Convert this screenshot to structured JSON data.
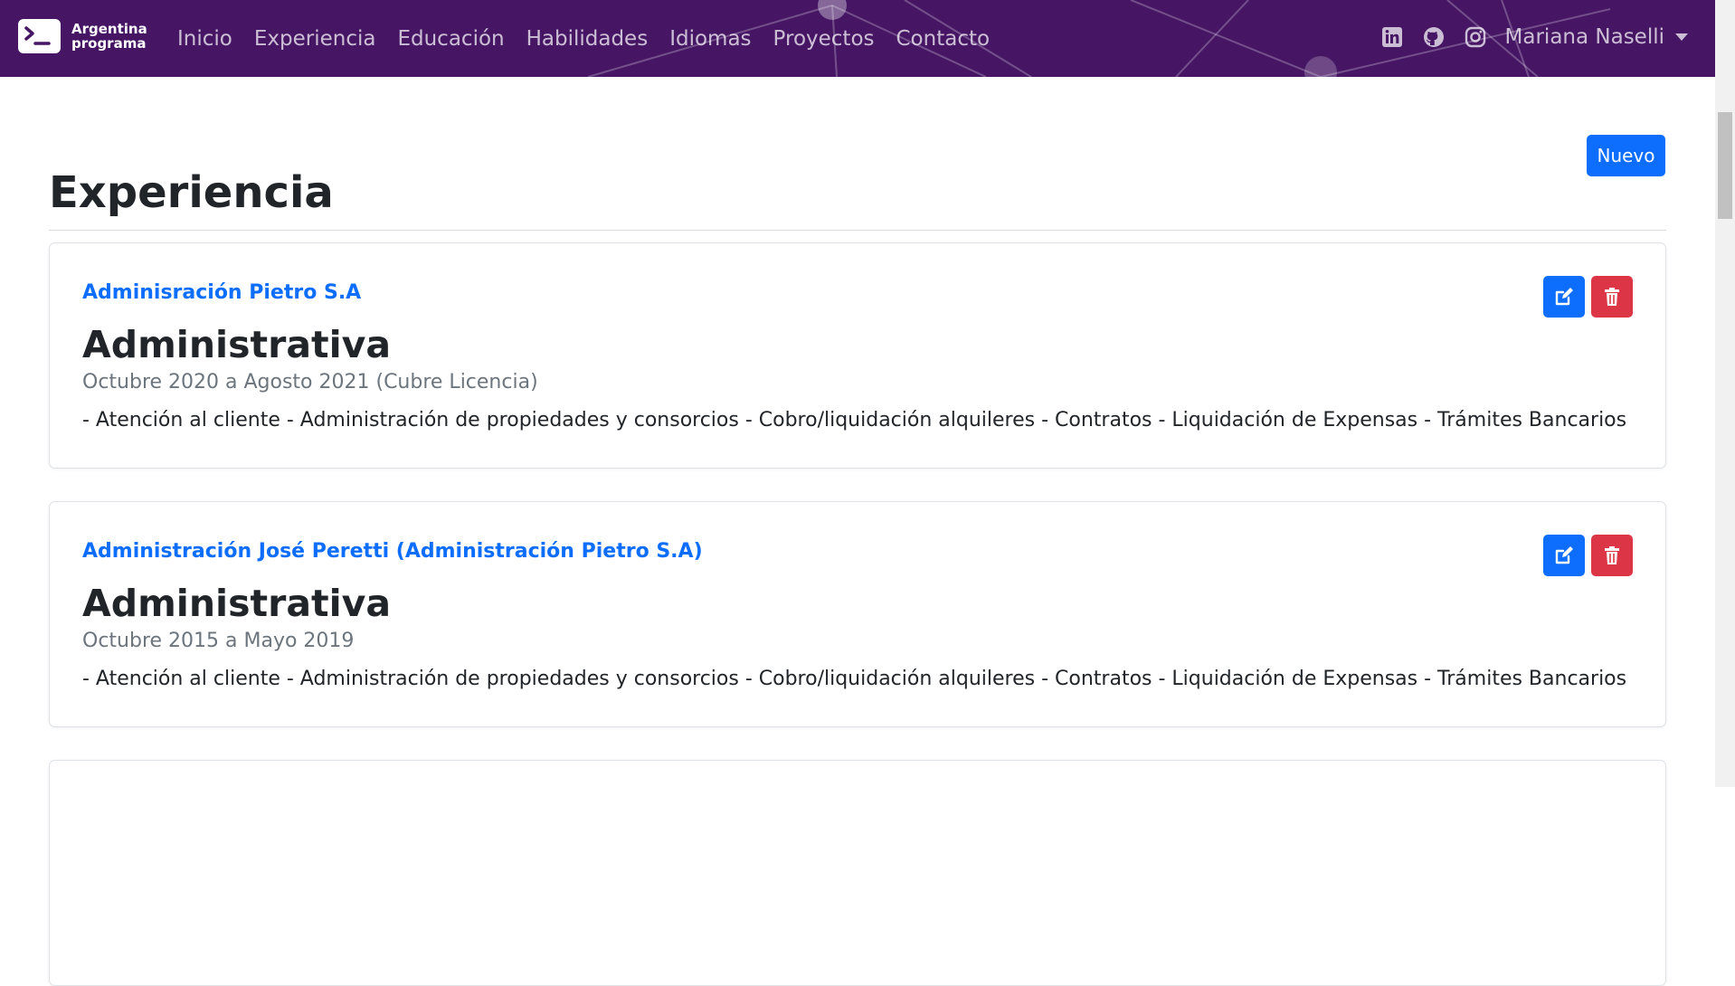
{
  "navbar": {
    "brand": {
      "line1": "Argentina",
      "line2": "programa",
      "icon": "terminal-icon"
    },
    "links": [
      "Inicio",
      "Experiencia",
      "Educación",
      "Habilidades",
      "Idiomas",
      "Proyectos",
      "Contacto"
    ],
    "social": [
      "linkedin-icon",
      "github-icon",
      "instagram-icon"
    ],
    "user": "Mariana Naselli",
    "bg_color": "#461665"
  },
  "main": {
    "new_button": "Nuevo",
    "section_title": "Experiencia",
    "cards": [
      {
        "company": "Adminisración Pietro S.A",
        "role": "Administrativa",
        "dates": "Octubre 2020 a Agosto 2021 (Cubre Licencia)",
        "description": "- Atención al cliente - Administración de propiedades y consorcios - Cobro/liquidación alquileres - Contratos - Liquidación de Expensas - Trámites Bancarios"
      },
      {
        "company": "Administración José Peretti (Administración Pietro S.A)",
        "role": "Administrativa",
        "dates": "Octubre 2015 a Mayo 2019",
        "description": "- Atención al cliente - Administración de propiedades y consorcios - Cobro/liquidación alquileres - Contratos - Liquidación de Expensas - Trámites Bancarios"
      }
    ]
  },
  "colors": {
    "primary": "#0d6efd",
    "danger": "#dc3545",
    "muted": "#6c757d"
  }
}
